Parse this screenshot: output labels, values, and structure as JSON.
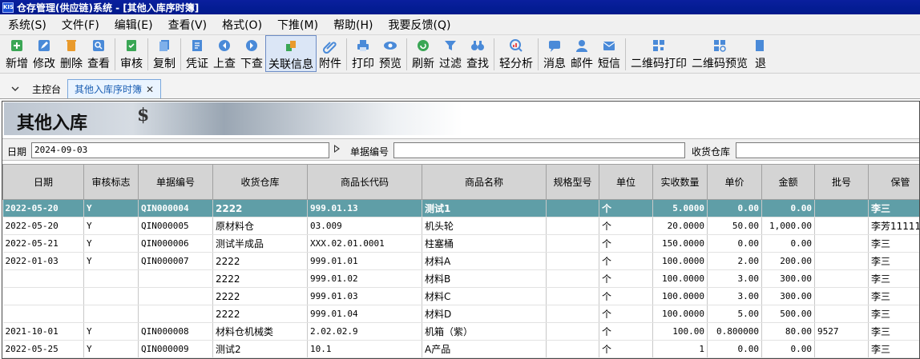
{
  "window": {
    "title": "仓存管理(供应链)系统 - [其他入库序时簿]",
    "logo_text": "KIS"
  },
  "menu": [
    "系统(S)",
    "文件(F)",
    "编辑(E)",
    "查看(V)",
    "格式(O)",
    "下推(M)",
    "帮助(H)",
    "我要反馈(Q)"
  ],
  "toolbar": [
    {
      "label": "新增",
      "icon": "plus-icon"
    },
    {
      "label": "修改",
      "icon": "edit-icon"
    },
    {
      "label": "删除",
      "icon": "trash-icon"
    },
    {
      "label": "查看",
      "icon": "view-icon"
    },
    {
      "sep": true
    },
    {
      "label": "审核",
      "icon": "check-icon"
    },
    {
      "sep": true
    },
    {
      "label": "复制",
      "icon": "copy-icon"
    },
    {
      "sep": true
    },
    {
      "label": "凭证",
      "icon": "voucher-icon"
    },
    {
      "label": "上查",
      "icon": "prev-icon"
    },
    {
      "label": "下查",
      "icon": "next-icon"
    },
    {
      "label": "关联信息",
      "icon": "link-icon",
      "active": true
    },
    {
      "label": "附件",
      "icon": "paperclip-icon"
    },
    {
      "sep": true
    },
    {
      "label": "打印",
      "icon": "printer-icon"
    },
    {
      "label": "预览",
      "icon": "preview-icon"
    },
    {
      "sep": true
    },
    {
      "label": "刷新",
      "icon": "refresh-icon"
    },
    {
      "label": "过滤",
      "icon": "filter-icon"
    },
    {
      "label": "查找",
      "icon": "binoculars-icon"
    },
    {
      "sep": true
    },
    {
      "label": "轻分析",
      "icon": "analysis-icon"
    },
    {
      "sep": true
    },
    {
      "label": "消息",
      "icon": "message-icon"
    },
    {
      "label": "邮件",
      "icon": "mail-icon"
    },
    {
      "label": "短信",
      "icon": "sms-icon"
    },
    {
      "sep": true
    },
    {
      "label": "二维码打印",
      "icon": "qrcode-icon"
    },
    {
      "label": "二维码预览",
      "icon": "qrcode-preview-icon"
    },
    {
      "label": "退",
      "icon": "exit-icon"
    }
  ],
  "tabs": [
    {
      "label": "主控台",
      "active": false
    },
    {
      "label": "其他入库序时簿",
      "active": true
    }
  ],
  "banner": {
    "title": "其他入库",
    "symbol": "$"
  },
  "filter": {
    "date_label": "日期",
    "date_value": "2024-09-03",
    "bill_label": "单据编号",
    "bill_value": "",
    "warehouse_label": "收货仓库",
    "warehouse_value": ""
  },
  "columns": [
    "日期",
    "审核标志",
    "单据编号",
    "收货仓库",
    "商品长代码",
    "商品名称",
    "规格型号",
    "单位",
    "实收数量",
    "单价",
    "金额",
    "批号",
    "保管"
  ],
  "rows": [
    {
      "date": "2022-05-20",
      "flag": "Y",
      "bill": "QIN000004",
      "wh": "2222",
      "code": "999.01.13",
      "name": "测试1",
      "spec": "",
      "unit": "个",
      "qty": "5.0000",
      "price": "0.00",
      "amount": "0.00",
      "batch": "",
      "keeper": "李三",
      "selected": true
    },
    {
      "date": "2022-05-20",
      "flag": "Y",
      "bill": "QIN000005",
      "wh": "原材料仓",
      "code": "03.009",
      "name": "机头轮",
      "spec": "",
      "unit": "个",
      "qty": "20.0000",
      "price": "50.00",
      "amount": "1,000.00",
      "batch": "",
      "keeper": "李芳11111"
    },
    {
      "date": "2022-05-21",
      "flag": "Y",
      "bill": "QIN000006",
      "wh": "测试半成品",
      "code": "XXX.02.01.0001",
      "name": "柱塞桶",
      "spec": "",
      "unit": "个",
      "qty": "150.0000",
      "price": "0.00",
      "amount": "0.00",
      "batch": "",
      "keeper": "李三"
    },
    {
      "date": "2022-01-03",
      "flag": "Y",
      "bill": "QIN000007",
      "wh": "2222",
      "code": "999.01.01",
      "name": "材料A",
      "spec": "",
      "unit": "个",
      "qty": "100.0000",
      "price": "2.00",
      "amount": "200.00",
      "batch": "",
      "keeper": "李三"
    },
    {
      "date": "",
      "flag": "",
      "bill": "",
      "wh": "2222",
      "code": "999.01.02",
      "name": "材料B",
      "spec": "",
      "unit": "个",
      "qty": "100.0000",
      "price": "3.00",
      "amount": "300.00",
      "batch": "",
      "keeper": "李三"
    },
    {
      "date": "",
      "flag": "",
      "bill": "",
      "wh": "2222",
      "code": "999.01.03",
      "name": "材料C",
      "spec": "",
      "unit": "个",
      "qty": "100.0000",
      "price": "3.00",
      "amount": "300.00",
      "batch": "",
      "keeper": "李三"
    },
    {
      "date": "",
      "flag": "",
      "bill": "",
      "wh": "2222",
      "code": "999.01.04",
      "name": "材料D",
      "spec": "",
      "unit": "个",
      "qty": "100.0000",
      "price": "5.00",
      "amount": "500.00",
      "batch": "",
      "keeper": "李三"
    },
    {
      "date": "2021-10-01",
      "flag": "Y",
      "bill": "QIN000008",
      "wh": "材料仓机械类",
      "code": "2.02.02.9",
      "name": "机箱（紫）",
      "spec": "",
      "unit": "个",
      "qty": "100.00",
      "price": "0.800000",
      "amount": "80.00",
      "batch": "9527",
      "keeper": "李三"
    },
    {
      "date": "2022-05-25",
      "flag": "Y",
      "bill": "QIN000009",
      "wh": "测试2",
      "code": "10.1",
      "name": "A产品",
      "spec": "",
      "unit": "个",
      "qty": "1",
      "price": "0.00",
      "amount": "0.00",
      "batch": "",
      "keeper": "李三"
    }
  ],
  "colors": {
    "selected_row": "#5f9ea7",
    "title_bar": "#0a1f9e",
    "active_tab_text": "#1c5fb3"
  }
}
